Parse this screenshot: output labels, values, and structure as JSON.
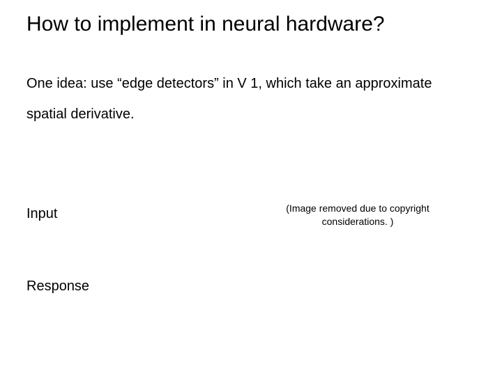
{
  "title": "How to implement in neural hardware?",
  "body": "One idea: use “edge detectors” in V 1, which take an approximate spatial derivative.",
  "labels": {
    "input": "Input",
    "response": "Response"
  },
  "notice": "(Image removed due to copyright considerations. )"
}
